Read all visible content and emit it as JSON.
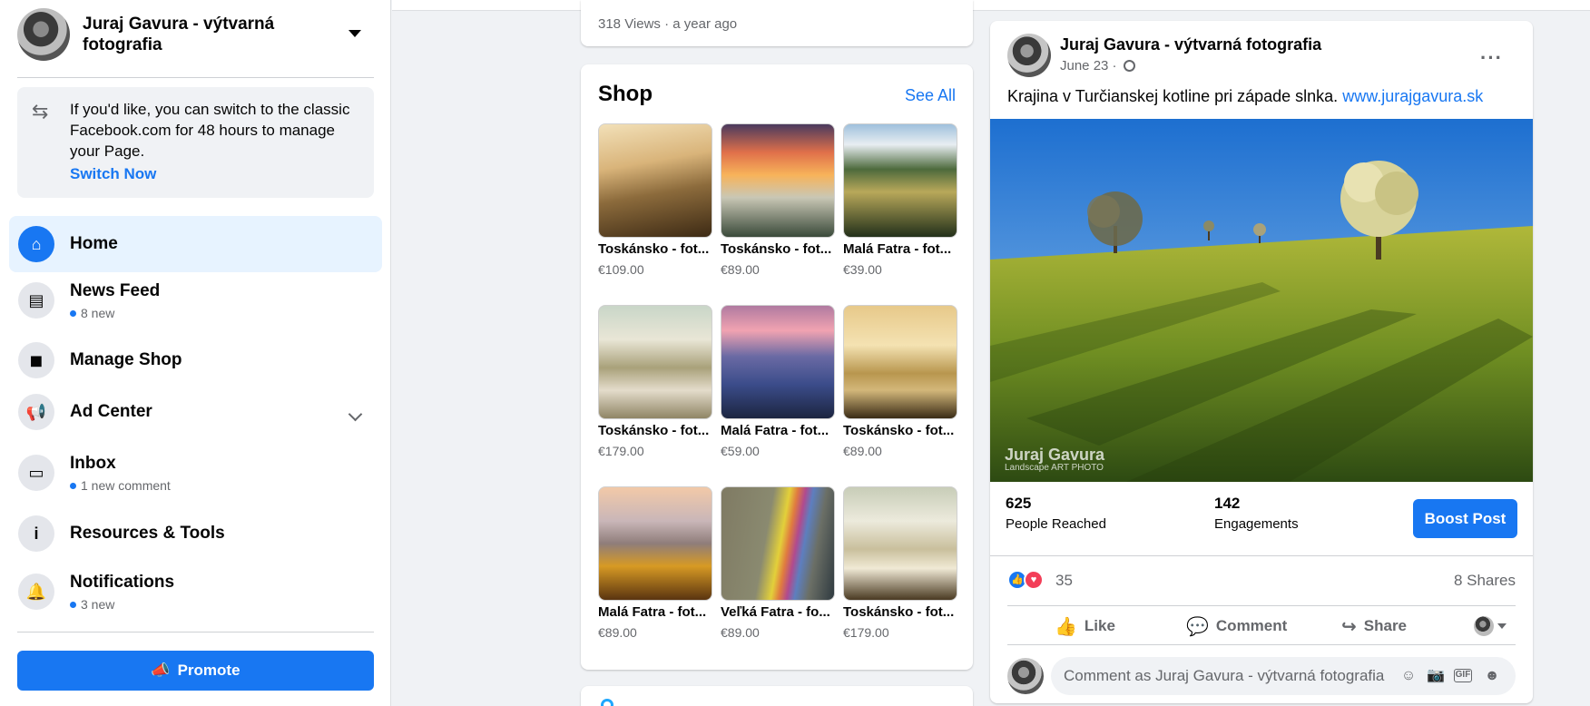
{
  "page": {
    "name": "Juraj Gavura - výtvarná fotografia"
  },
  "switch_notice": {
    "text": "If you'd like, you can switch to the classic Facebook.com for 48 hours to manage your Page.",
    "link": "Switch Now"
  },
  "nav": [
    {
      "label": "Home",
      "sub": "",
      "icon": "home-icon",
      "active": true
    },
    {
      "label": "News Feed",
      "sub": "8 new",
      "icon": "news-feed-icon"
    },
    {
      "label": "Manage Shop",
      "sub": "",
      "icon": "shopping-bag-icon"
    },
    {
      "label": "Ad Center",
      "sub": "",
      "icon": "megaphone-icon",
      "expandable": true
    },
    {
      "label": "Inbox",
      "sub": "1 new comment",
      "icon": "inbox-icon"
    },
    {
      "label": "Resources & Tools",
      "sub": "",
      "icon": "info-icon"
    },
    {
      "label": "Notifications",
      "sub": "3 new",
      "icon": "bell-icon"
    }
  ],
  "promote_label": "Promote",
  "video_card": {
    "meta": "318 Views · a year ago"
  },
  "shop": {
    "title": "Shop",
    "see_all": "See All",
    "products": [
      {
        "name": "Toskánsko - fot...",
        "price": "€109.00"
      },
      {
        "name": "Toskánsko - fot...",
        "price": "€89.00"
      },
      {
        "name": "Malá Fatra - fot...",
        "price": "€39.00"
      },
      {
        "name": "Toskánsko - fot...",
        "price": "€179.00"
      },
      {
        "name": "Malá Fatra - fot...",
        "price": "€59.00"
      },
      {
        "name": "Toskánsko - fot...",
        "price": "€89.00"
      },
      {
        "name": "Malá Fatra - fot...",
        "price": "€89.00"
      },
      {
        "name": "Veľká Fatra - fo...",
        "price": "€89.00"
      },
      {
        "name": "Toskánsko - fot...",
        "price": "€179.00"
      }
    ]
  },
  "post": {
    "author": "Juraj Gavura - výtvarná fotografia",
    "date": "June 23 ·",
    "text": "Krajina v Turčianskej kotline pri západe slnka.",
    "link": "www.jurajgavura.sk",
    "watermark": "Juraj Gavura",
    "watermark_sub": "Landscape ART PHOTO",
    "reach_value": "625",
    "reach_label": "People Reached",
    "engagements_value": "142",
    "engagements_label": "Engagements",
    "boost_label": "Boost Post",
    "reaction_count": "35",
    "shares": "8 Shares",
    "like_label": "Like",
    "comment_label": "Comment",
    "share_label": "Share",
    "comment_placeholder": "Comment as Juraj Gavura - výtvarná fotografia"
  },
  "colors": {
    "accent": "#1877f2",
    "background": "#f0f2f5",
    "active_nav": "#e7f3ff",
    "love": "#f33e58"
  }
}
